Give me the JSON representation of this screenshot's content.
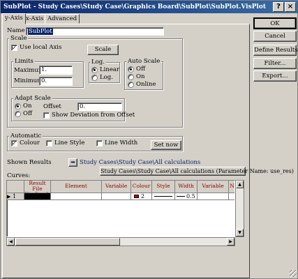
{
  "window": {
    "title": "SubPlot - Study Cases\\Study Case\\Graphics Board\\SubPlot\\SubPlot.VisPlot",
    "help": "?",
    "close": "×"
  },
  "tabs": [
    {
      "label": "y-Axis"
    },
    {
      "label": "x-Axis"
    },
    {
      "label": "Advanced"
    }
  ],
  "name": {
    "label": "Name",
    "value": "SubPlot"
  },
  "scale": {
    "group_label": "Scale",
    "use_local_axis_label": "Use local Axis",
    "use_local_axis_checked": true,
    "scale_button": "Scale",
    "limits": {
      "label": "Limits",
      "maximum_label": "Maximum",
      "maximum_value": "1.",
      "minimum_label": "Minimum",
      "minimum_value": "0."
    },
    "log": {
      "label": "Log.",
      "linear": "Linear",
      "log": "Log.",
      "selected": "Linear"
    },
    "auto_scale": {
      "label": "Auto Scale",
      "off": "Off",
      "on": "On",
      "online": "Online",
      "selected": "Off"
    },
    "adapt_scale": {
      "label": "Adapt Scale",
      "on": "On",
      "off": "Off",
      "selected": "On",
      "offset_label": "Offset",
      "offset_value": "0.",
      "show_deviation_label": "Show Deviation from Offset"
    }
  },
  "automatic": {
    "label": "Automatic",
    "colour": "Colour",
    "colour_checked": true,
    "line_style": "Line Style",
    "line_width": "Line Width",
    "set_now": "Set now"
  },
  "shown_results": {
    "label": "Shown Results",
    "arrow": "➡",
    "value": "Study Cases\\Study Case\\All calculations",
    "param_button": "Study Cases\\Study Case\\All calculations  (Parameter Name: use_res)"
  },
  "curves": {
    "label": "Curves:",
    "columns": [
      "Result File ElmRes,I...",
      "Element",
      "Variable",
      "Colour",
      "Style",
      "Width",
      "Variable D...",
      "N"
    ],
    "rows": [
      {
        "marker": "▶",
        "index": "1",
        "result_file": "",
        "element": "",
        "variable": "",
        "colour_index": "2",
        "style": "",
        "width": "0.5",
        "variable_d": "",
        "n": ""
      }
    ],
    "colour_swatch": "#cc0000"
  },
  "side_buttons": {
    "ok": "OK",
    "cancel": "Cancel",
    "define_results": "Define Results",
    "filter": "Filter...",
    "export": "Export..."
  }
}
